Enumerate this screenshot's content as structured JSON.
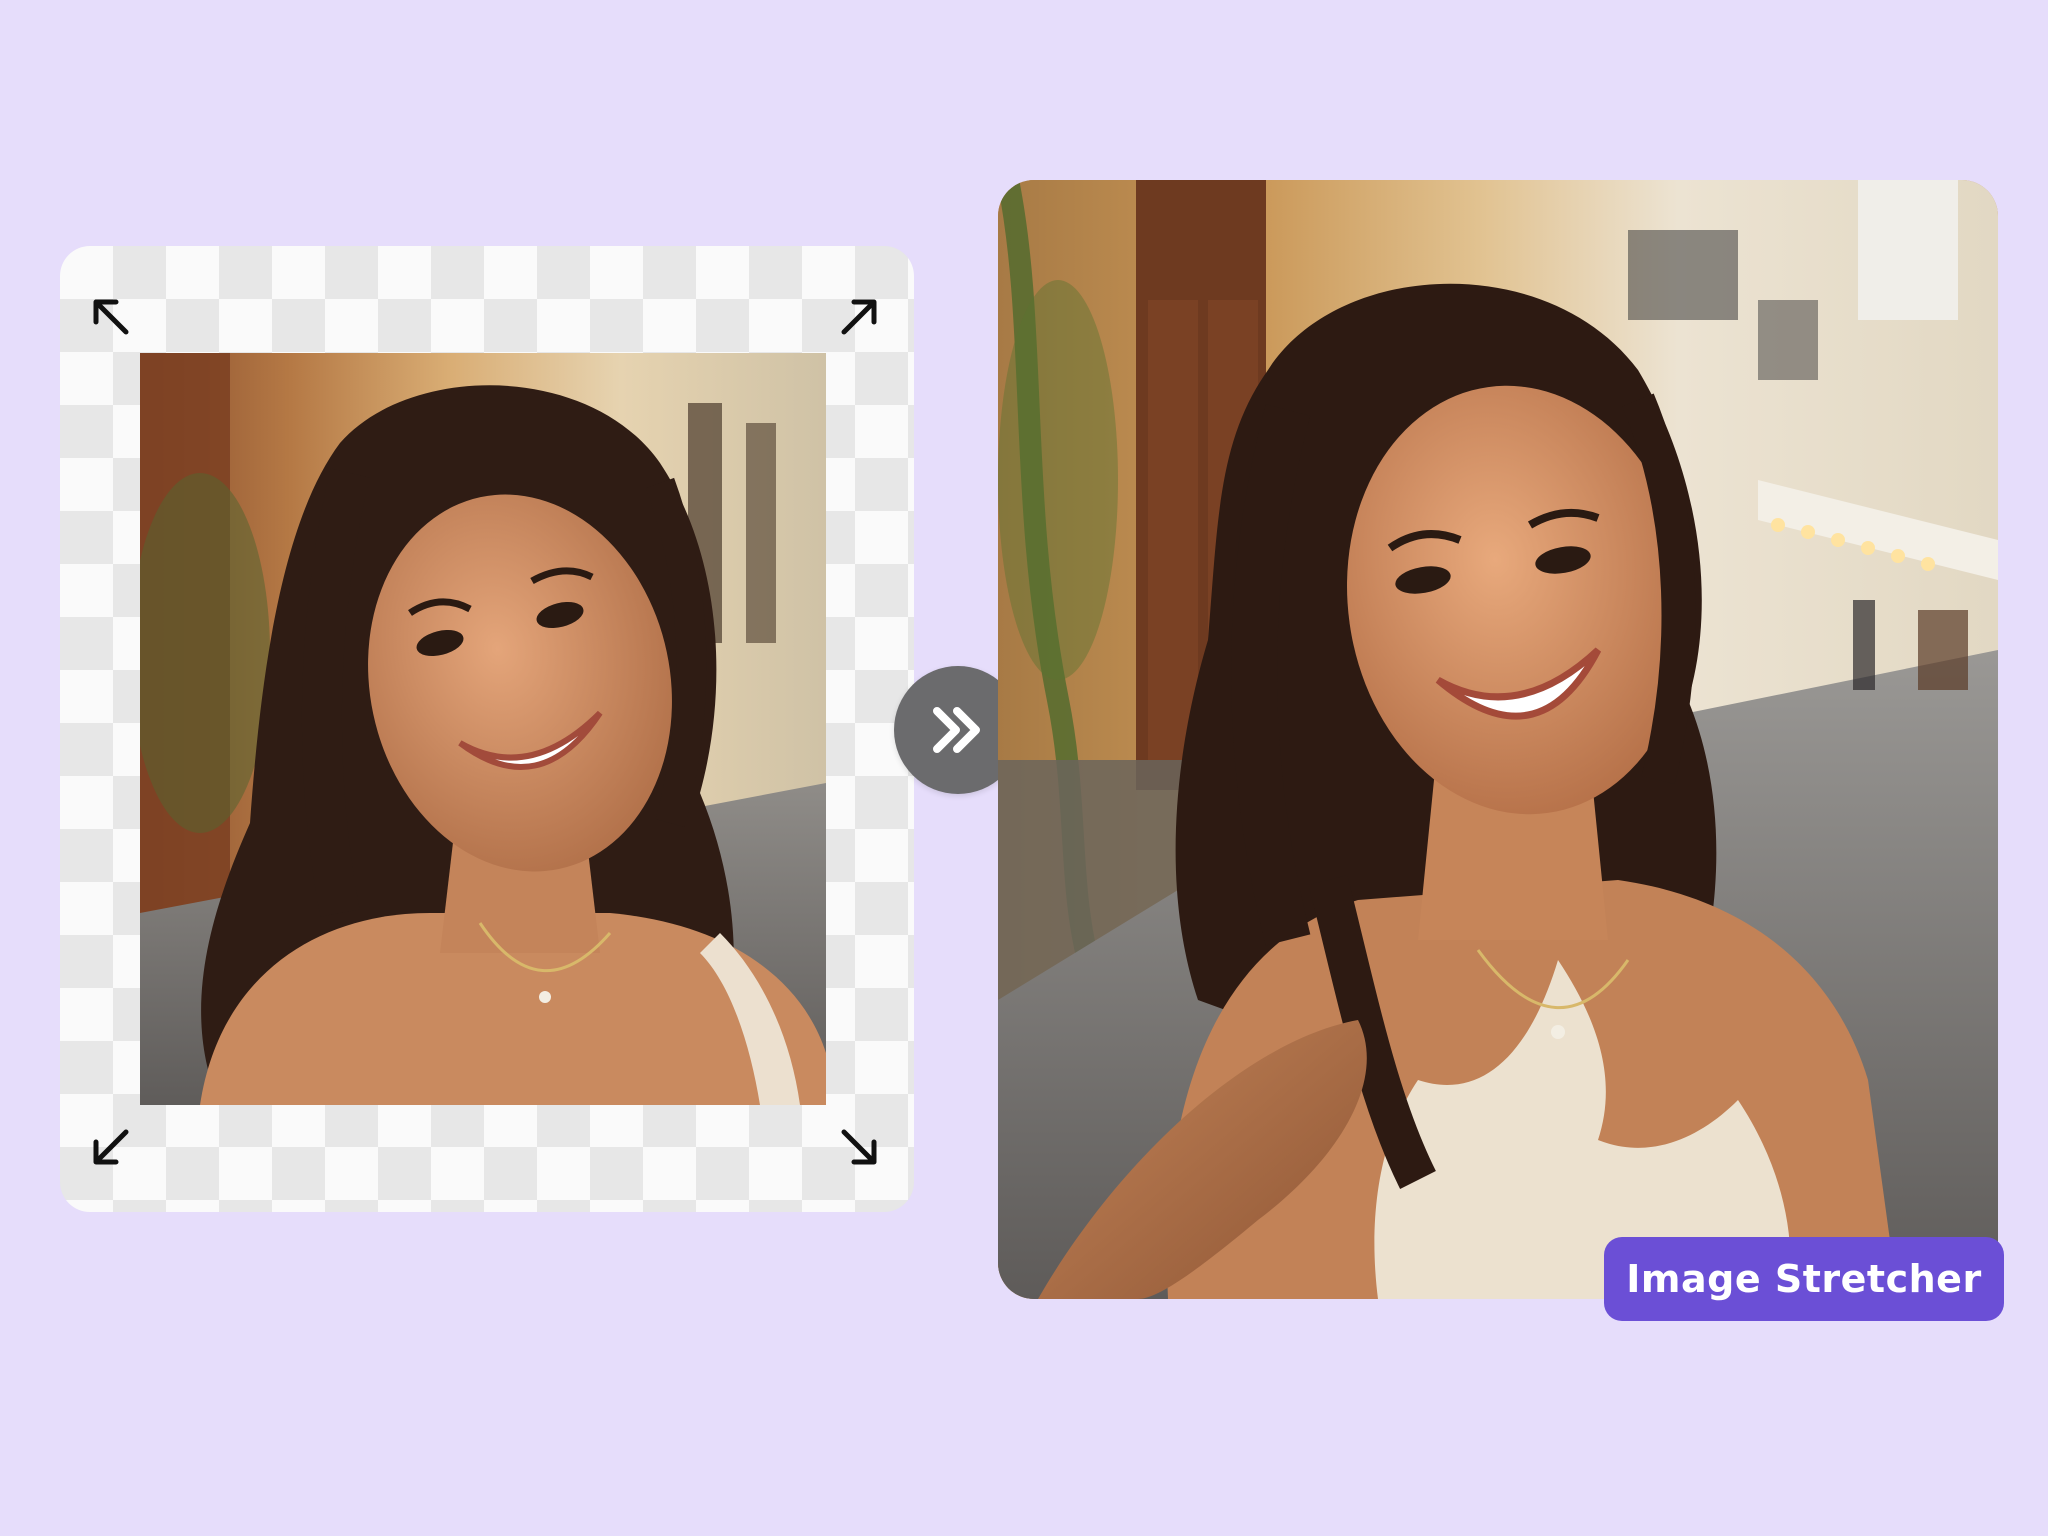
{
  "brand": {
    "badge_label": "Image Stretcher",
    "badge_color": "#6b4fd6"
  },
  "source_panel": {
    "background": "transparency-checkerboard",
    "corner_icons": [
      "arrow-up-left-icon",
      "arrow-up-right-icon",
      "arrow-down-left-icon",
      "arrow-down-right-icon"
    ]
  },
  "action": {
    "icon": "double-chevron-right-icon",
    "button_color": "#6b6b6d"
  },
  "result_panel": {
    "image": "expanded-photo"
  },
  "colors": {
    "page_background": "#e6ddfb"
  }
}
